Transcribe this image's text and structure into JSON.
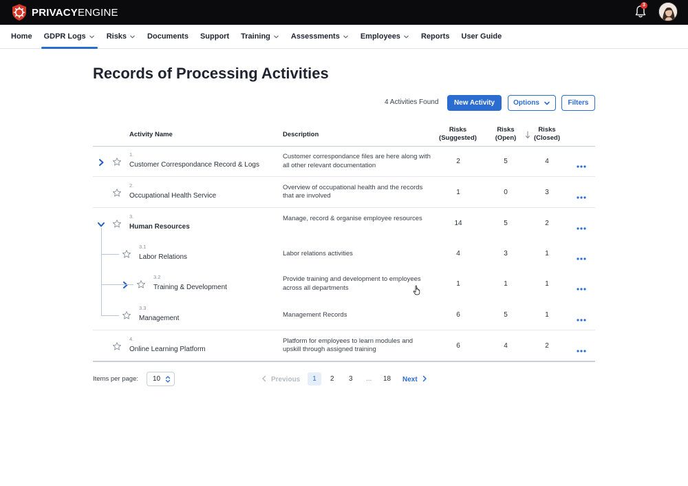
{
  "brand": {
    "name_bold": "PRIVACY",
    "name_light": "ENGINE"
  },
  "notifications": {
    "count": "3"
  },
  "nav": [
    {
      "label": "Home",
      "has_menu": false,
      "active": false
    },
    {
      "label": "GDPR Logs",
      "has_menu": true,
      "active": true
    },
    {
      "label": "Risks",
      "has_menu": true,
      "active": false
    },
    {
      "label": "Documents",
      "has_menu": false,
      "active": false
    },
    {
      "label": "Support",
      "has_menu": false,
      "active": false
    },
    {
      "label": "Training",
      "has_menu": true,
      "active": false
    },
    {
      "label": "Assessments",
      "has_menu": true,
      "active": false
    },
    {
      "label": "Employees",
      "has_menu": true,
      "active": false
    },
    {
      "label": "Reports",
      "has_menu": false,
      "active": false
    },
    {
      "label": "User Guide",
      "has_menu": false,
      "active": false
    }
  ],
  "page": {
    "title": "Records of Processing Activities",
    "found_text": "4 Activities Found",
    "new_activity": "New Activity",
    "options": "Options",
    "filters": "Filters"
  },
  "table": {
    "headers": {
      "name": "Activity Name",
      "description": "Description",
      "suggested": [
        "Risks",
        "(Suggested)"
      ],
      "open": [
        "Risks",
        "(Open)"
      ],
      "closed": [
        "Risks",
        "(Closed)"
      ]
    },
    "rows": [
      {
        "num": "1.",
        "name": "Customer Correspondance Record & Logs",
        "bold": false,
        "level": 0,
        "expander": "collapsed",
        "description": "Customer correspondance files are here along with all other relevant documentation",
        "suggested": "2",
        "open": "5",
        "closed": "4"
      },
      {
        "num": "2.",
        "name": "Occupational Health Service",
        "bold": false,
        "level": 0,
        "expander": "none",
        "description": "Overview of occupational health and the records that are involved",
        "suggested": "1",
        "open": "0",
        "closed": "3"
      },
      {
        "num": "3.",
        "name": "Human Resources",
        "bold": true,
        "level": 0,
        "expander": "expanded",
        "description": "Manage, record & organise employee resources",
        "suggested": "14",
        "open": "5",
        "closed": "2"
      },
      {
        "num": "3.1",
        "name": "Labor Relations",
        "bold": false,
        "level": 1,
        "expander": "none",
        "description": "Labor relations activities",
        "suggested": "4",
        "open": "3",
        "closed": "1"
      },
      {
        "num": "3.2",
        "name": "Training & Development",
        "bold": false,
        "level": 1,
        "expander": "collapsed",
        "description": "Provide training and development to employees across all departments",
        "suggested": "1",
        "open": "1",
        "closed": "1"
      },
      {
        "num": "3.3",
        "name": "Management",
        "bold": false,
        "level": 1,
        "expander": "none",
        "description": "Management Records",
        "suggested": "6",
        "open": "5",
        "closed": "1"
      },
      {
        "num": "4.",
        "name": "Online Learning Platform",
        "bold": false,
        "level": 0,
        "expander": "none",
        "description": "Platform for employees to learn modules and upskill through assigned training",
        "suggested": "6",
        "open": "4",
        "closed": "2"
      }
    ]
  },
  "pagination": {
    "items_per_page_label": "Items per page:",
    "items_per_page": "10",
    "previous": "Previous",
    "pages": [
      "1",
      "2",
      "3"
    ],
    "ellipsis": "...",
    "last_page": "18",
    "next": "Next"
  },
  "colors": {
    "accent": "#2b6cd0",
    "topbar": "#0b0b0d",
    "brand_red": "#d33a2c"
  }
}
